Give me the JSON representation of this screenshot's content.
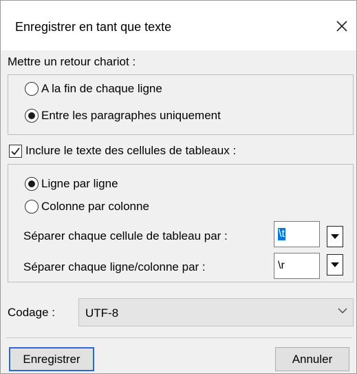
{
  "window": {
    "title": "Enregistrer en tant que texte",
    "close_icon": "close-icon"
  },
  "carriage_return": {
    "label": "Mettre un retour chariot :",
    "options": [
      {
        "label": "A la fin de chaque ligne",
        "selected": false
      },
      {
        "label": "Entre les paragraphes uniquement",
        "selected": true
      }
    ]
  },
  "table_cells": {
    "checkbox_label": "Inclure le texte des cellules de tableaux :",
    "checked": true,
    "options": [
      {
        "label": "Ligne par ligne",
        "selected": true
      },
      {
        "label": "Colonne par colonne",
        "selected": false
      }
    ],
    "cell_separator": {
      "label": "Séparer chaque cellule de tableau par :",
      "value": "\\t"
    },
    "row_separator": {
      "label": "Séparer chaque ligne/colonne par :",
      "value": "\\r"
    }
  },
  "encoding": {
    "label": "Codage :",
    "value": "UTF-8"
  },
  "buttons": {
    "save": "Enregistrer",
    "cancel": "Annuler"
  },
  "colors": {
    "accent": "#0078d7",
    "default_button_border": "#2b6ad6"
  }
}
